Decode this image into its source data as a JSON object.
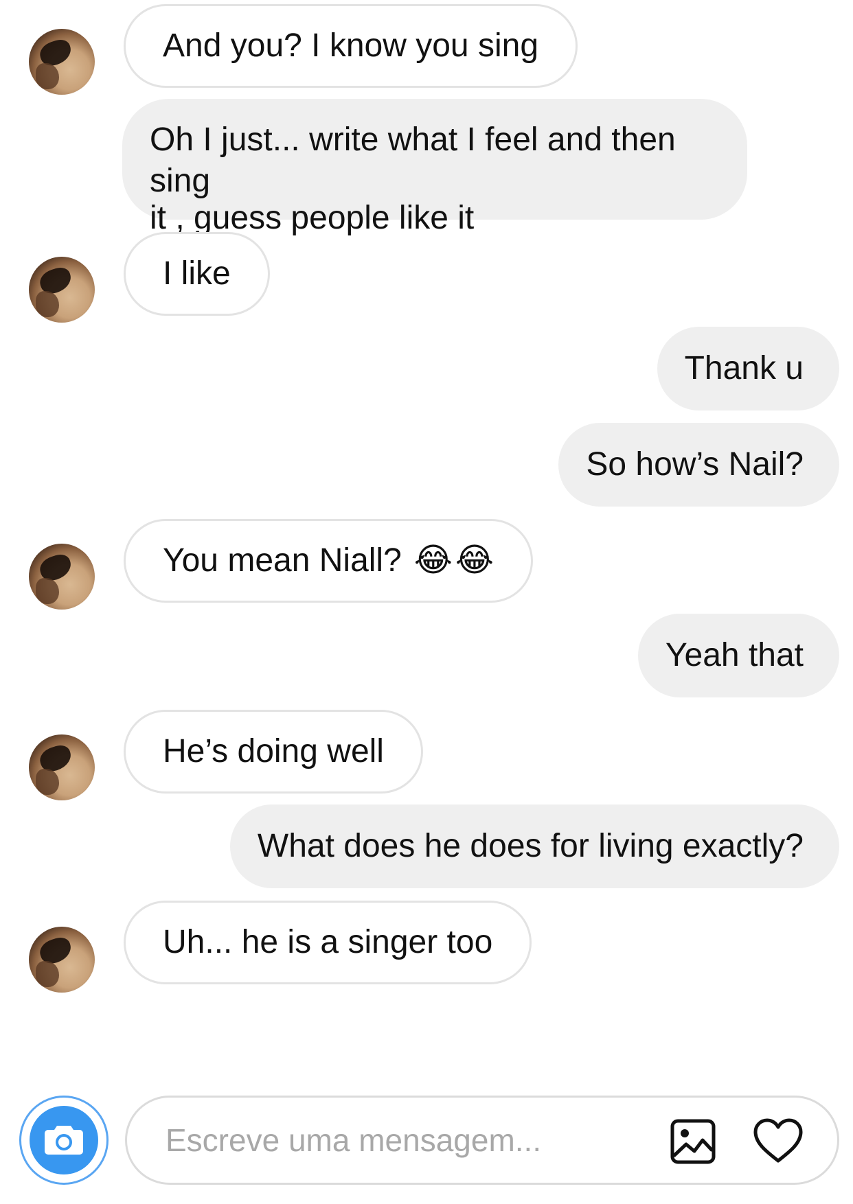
{
  "messages": [
    {
      "direction": "incoming",
      "text": "And you? I know you sing"
    },
    {
      "direction": "outgoing",
      "lines": [
        "Oh I just... write what I feel and then sing",
        "it , guess people like it"
      ]
    },
    {
      "direction": "incoming",
      "text": "I like"
    },
    {
      "direction": "outgoing",
      "text": "Thank u"
    },
    {
      "direction": "outgoing",
      "text": "So how’s Nail?"
    },
    {
      "direction": "incoming",
      "text": "You mean Niall?",
      "emoji": "😂"
    },
    {
      "direction": "outgoing",
      "text": "Yeah that"
    },
    {
      "direction": "incoming",
      "text": "He’s doing well"
    },
    {
      "direction": "outgoing",
      "text": "What does he does for living exactly?"
    },
    {
      "direction": "incoming",
      "text": "Uh... he is a singer too"
    }
  ],
  "composer": {
    "placeholder": "Escreve uma mensagem...",
    "camera_icon": "camera-icon",
    "gallery_icon": "gallery-icon",
    "like_icon": "heart-icon"
  },
  "colors": {
    "incoming_bubble_border": "#e3e3e3",
    "outgoing_bubble_bg": "#efefef",
    "camera_blue": "#3897f0",
    "placeholder_gray": "#a8a8a8"
  }
}
